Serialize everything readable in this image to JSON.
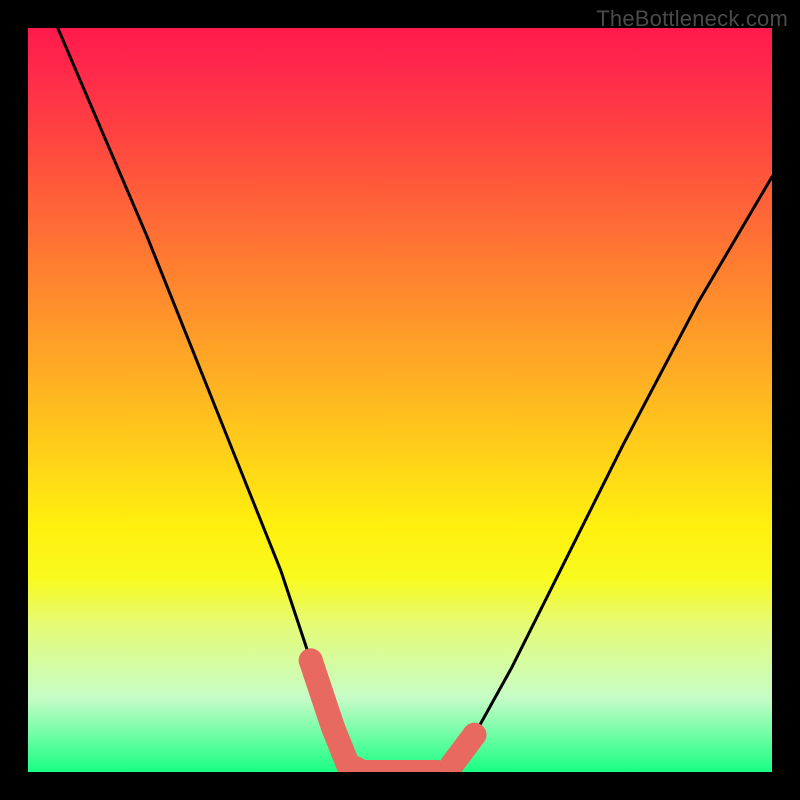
{
  "watermark": "TheBottleneck.com",
  "chart_data": {
    "type": "line",
    "title": "",
    "xlabel": "",
    "ylabel": "",
    "xlim": [
      0,
      100
    ],
    "ylim": [
      0,
      100
    ],
    "series": [
      {
        "name": "curve",
        "x": [
          4,
          10,
          16,
          22,
          28,
          34,
          38,
          41,
          43,
          45,
          47,
          50,
          53,
          55,
          57,
          60,
          65,
          72,
          80,
          90,
          100
        ],
        "y": [
          100,
          86,
          72,
          57,
          42,
          27,
          15,
          6,
          1,
          0,
          0,
          0,
          0,
          0,
          1,
          5,
          14,
          28,
          44,
          63,
          80
        ]
      }
    ],
    "highlight_segments": [
      {
        "x": [
          38,
          41,
          43,
          45
        ],
        "y": [
          15,
          6,
          1,
          0
        ]
      },
      {
        "x": [
          45,
          47,
          50,
          53,
          55
        ],
        "y": [
          0,
          0,
          0,
          0,
          0
        ]
      },
      {
        "x": [
          57,
          60
        ],
        "y": [
          1,
          5
        ]
      }
    ],
    "colors": {
      "curve": "#000000",
      "highlight": "#e8695f",
      "background_top": "#ff1a4d",
      "background_bottom": "#19ff84"
    }
  }
}
